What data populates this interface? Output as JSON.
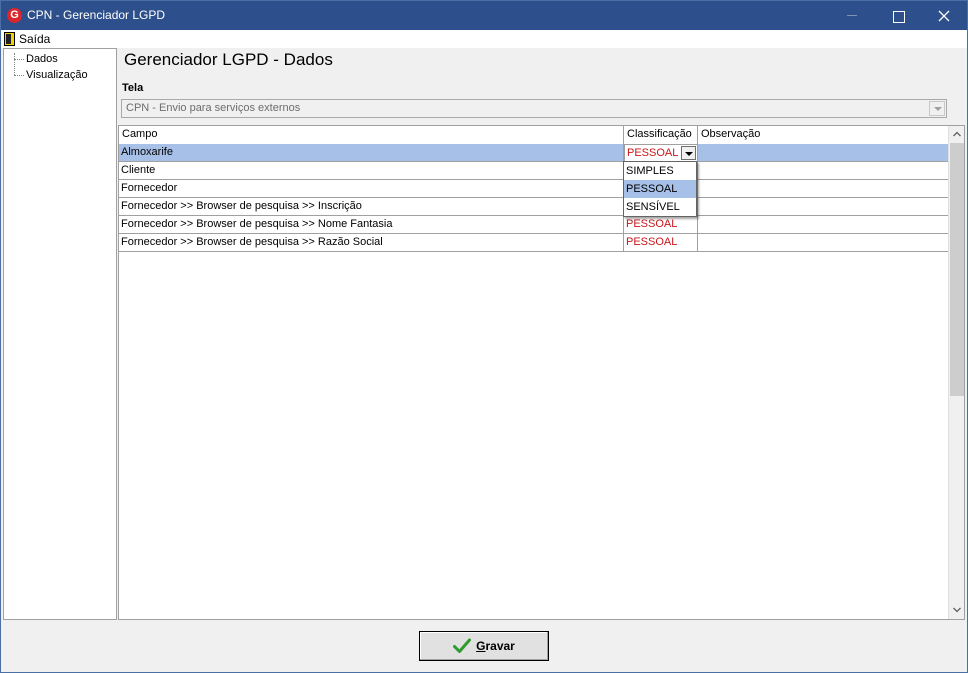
{
  "window": {
    "title": "CPN - Gerenciador LGPD",
    "app_icon": "G"
  },
  "menu": {
    "items": [
      {
        "label": "Saída",
        "icon": "door-icon"
      }
    ]
  },
  "sidebar": {
    "items": [
      {
        "label": "Dados"
      },
      {
        "label": "Visualização"
      }
    ]
  },
  "page": {
    "heading": "Gerenciador LGPD - Dados"
  },
  "tela": {
    "label": "Tela",
    "selected": "CPN - Envio para serviços externos"
  },
  "grid": {
    "columns": [
      "Campo",
      "Classificação",
      "Observação"
    ],
    "rows": [
      {
        "campo": "Almoxarife",
        "classificacao": "PESSOAL",
        "observacao": ""
      },
      {
        "campo": "Cliente",
        "classificacao": "",
        "observacao": ""
      },
      {
        "campo": "Fornecedor",
        "classificacao": "",
        "observacao": ""
      },
      {
        "campo": "Fornecedor >> Browser de pesquisa >> Inscrição",
        "classificacao": "",
        "observacao": ""
      },
      {
        "campo": "Fornecedor >> Browser de pesquisa >> Nome Fantasia",
        "classificacao": "PESSOAL",
        "observacao": ""
      },
      {
        "campo": "Fornecedor >> Browser de pesquisa >> Razão Social",
        "classificacao": "PESSOAL",
        "observacao": ""
      }
    ],
    "selected_row": 0,
    "editor_value": "PESSOAL",
    "dropdown_options": [
      "SIMPLES",
      "PESSOAL",
      "SENSÍVEL"
    ],
    "dropdown_highlighted": "PESSOAL"
  },
  "footer": {
    "save_label": "Gravar",
    "save_icon": "check-icon"
  },
  "colors": {
    "titlebar": "#2d4f8b",
    "selection": "#a7c0e8",
    "classification_text": "#c8171b",
    "check_green": "#2e9b2e"
  }
}
